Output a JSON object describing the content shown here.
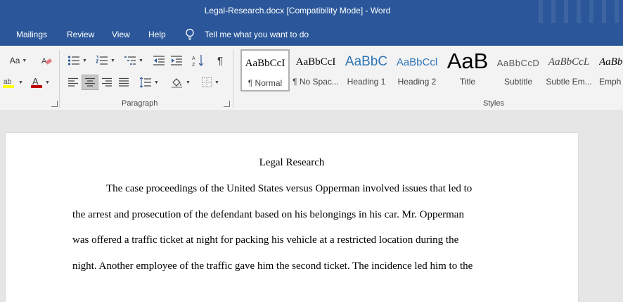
{
  "window": {
    "title": "Legal-Research.docx [Compatibility Mode]  -  Word"
  },
  "tabs": [
    "Mailings",
    "Review",
    "View",
    "Help"
  ],
  "tell_me": {
    "text": "Tell me what you want to do",
    "icon": "lightbulb-icon"
  },
  "ribbon": {
    "font_group": {
      "change_case": "Aa",
      "clear_format_icon": "clear-formatting-icon"
    },
    "paragraph_label": "Paragraph",
    "styles_label": "Styles",
    "styles": [
      {
        "sample": "AaBbCcI",
        "name": "¶ Normal",
        "color": "#000000",
        "active": true
      },
      {
        "sample": "AaBbCcI",
        "name": "¶ No Spac...",
        "color": "#000000"
      },
      {
        "sample": "AaBbC",
        "name": "Heading 1",
        "color": "#2e74b5"
      },
      {
        "sample": "AaBbCcl",
        "name": "Heading 2",
        "color": "#2e74b5"
      },
      {
        "sample": "AaB",
        "name": "Title",
        "color": "#000000"
      },
      {
        "sample": "AaBbCcD",
        "name": "Subtitle",
        "color": "#595959"
      },
      {
        "sample": "AaBbCcL",
        "name": "Subtle Em...",
        "color": "#404040"
      },
      {
        "sample": "AaBb",
        "name": "Emph",
        "color": "#000000"
      }
    ]
  },
  "colors": {
    "titlebar": "#2b579a",
    "highlight": "#ffff00",
    "font_color": "#c00000",
    "heading": "#2e74b5"
  },
  "document": {
    "title": "Legal Research",
    "lines": [
      "The case proceedings of the United States versus Opperman involved issues that led to",
      "the arrest and prosecution of the defendant based on his belongings in his car. Mr. Opperman",
      "was offered a traffic ticket at night for packing his vehicle at a restricted location during the",
      "night. Another employee of the traffic gave him the second ticket. The incidence led him to the"
    ]
  }
}
